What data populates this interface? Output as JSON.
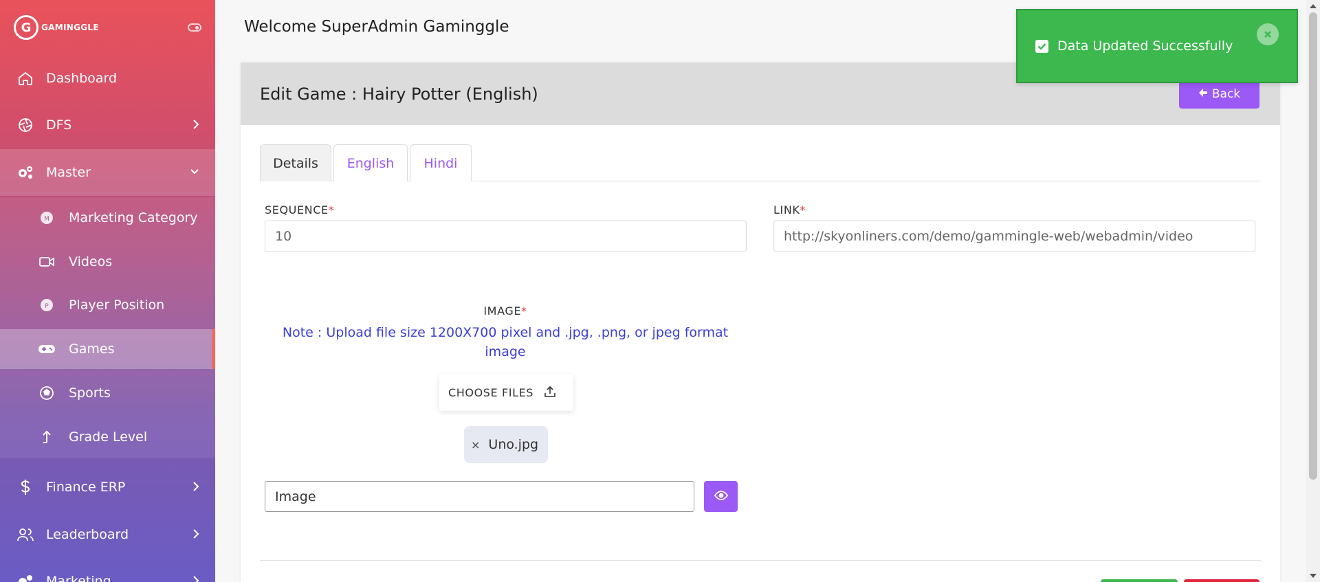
{
  "brand": {
    "logo_letter": "G",
    "name": "GAMINGGLE"
  },
  "sidebar": {
    "items": [
      {
        "label": "Dashboard",
        "icon": "home-icon"
      },
      {
        "label": "DFS",
        "icon": "aperture-icon"
      },
      {
        "label": "Master",
        "icon": "gears-icon"
      },
      {
        "label": "Finance ERP",
        "icon": "dollar-icon"
      },
      {
        "label": "Leaderboard",
        "icon": "users-icon"
      },
      {
        "label": "Marketing",
        "icon": "gears-icon"
      }
    ],
    "sub_items": [
      {
        "label": "Marketing Category",
        "icon": "badge-icon"
      },
      {
        "label": "Videos",
        "icon": "video-icon"
      },
      {
        "label": "Player Position",
        "icon": "badge-icon"
      },
      {
        "label": "Games",
        "icon": "gamepad-icon"
      },
      {
        "label": "Sports",
        "icon": "soccer-ball-icon"
      },
      {
        "label": "Grade Level",
        "icon": "arrow-up-icon"
      }
    ]
  },
  "header": {
    "welcome": "Welcome SuperAdmin Gaminggle"
  },
  "page": {
    "title": "Edit Game : Hairy Potter (English)",
    "back_label": "Back",
    "tabs": [
      {
        "label": "Details"
      },
      {
        "label": "English"
      },
      {
        "label": "Hindi"
      }
    ]
  },
  "form": {
    "sequence_label": "SEQUENCE",
    "sequence_value": "10",
    "link_label": "LINK",
    "link_value": "http://skyonliners.com/demo/gammingle-web/webadmin/video",
    "image_label": "IMAGE",
    "required_mark": "*",
    "note": "Note : Upload file size 1200X700 pixel and .jpg, .png, or jpeg format image",
    "choose_files_label": "CHOOSE FILES",
    "file_name": "Uno.jpg",
    "file_remove": "×",
    "image_field_value": "Image"
  },
  "toast": {
    "message": "Data Updated Successfully",
    "color": "#3cb84e"
  },
  "colors": {
    "accent": "#9b59f6",
    "required": "#e23b3b",
    "note": "#3b3fd6"
  }
}
